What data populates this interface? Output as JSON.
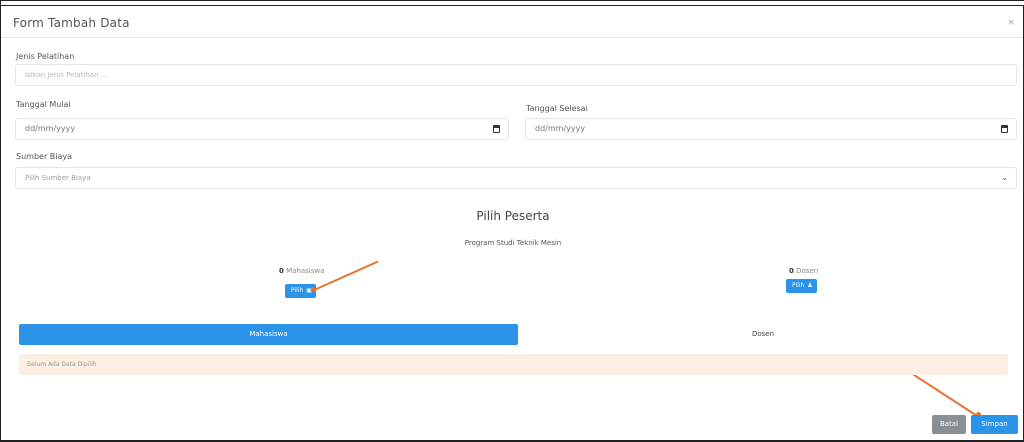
{
  "modal": {
    "title": "Form Tambah Data",
    "close_label": "×"
  },
  "form": {
    "jenis_label": "Jenis Pelatihan",
    "jenis_placeholder": "Isikan Jenis Pelatihan ...",
    "mulai_label": "Tanggal Mulai",
    "mulai_value": "dd/mm/yyyy",
    "selesai_label": "Tanggal Selesai",
    "selesai_value": "dd/mm/yyyy",
    "sumber_label": "Sumber Biaya",
    "sumber_value": "Pilih Sumber Biaya"
  },
  "peserta": {
    "title": "Pilih Peserta",
    "program": "Program Studi Teknik Mesin",
    "mahasiswa_count": "0",
    "mahasiswa_label": "Mahasiswa",
    "mahasiswa_btn": "Pilih",
    "dosen_count": "0",
    "dosen_label": "Dosen",
    "dosen_btn": "Pilih"
  },
  "tabs": {
    "mahasiswa": "Mahasiswa",
    "dosen": "Dosen"
  },
  "alert": {
    "empty_text": "Belum Ada Data Dipilih"
  },
  "footer": {
    "batal": "Batal",
    "simpan": "Simpan"
  },
  "colors": {
    "primary": "#2b93e8",
    "annotation": "#e8722c",
    "alert_bg": "#fbeee2",
    "secondary": "#8a8f94"
  },
  "icons": {
    "date_field": "calendar-icon",
    "select_field": "chevron-down-icon",
    "mahasiswa_button": "clipboard-icon",
    "dosen_button": "user-icon"
  }
}
